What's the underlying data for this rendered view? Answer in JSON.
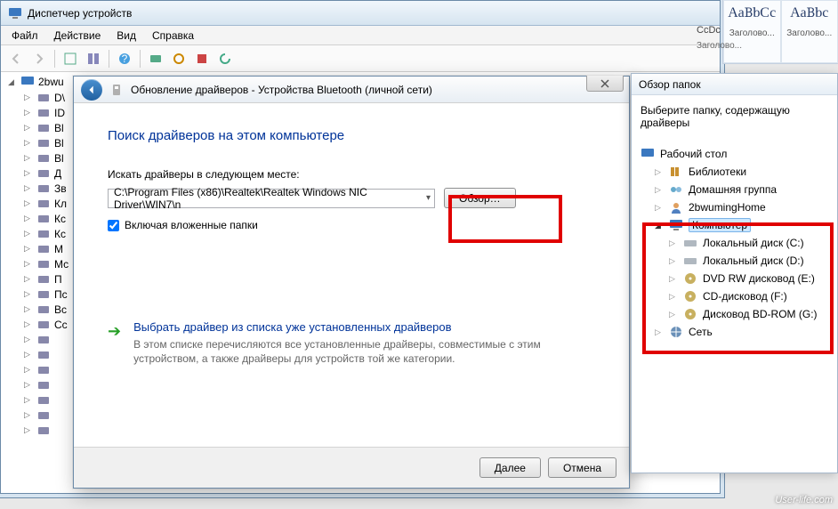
{
  "devmgr": {
    "title": "Диспетчер устройств",
    "menu": {
      "file": "Файл",
      "action": "Действие",
      "view": "Вид",
      "help": "Справка"
    },
    "root": "2bwu",
    "items": [
      "D\\",
      "ID",
      "Bl",
      "Bl",
      "Bl",
      "Д",
      "Зв",
      "Кл",
      "Кс",
      "Кс",
      "М",
      "Мс",
      "П",
      "Пс",
      "Вс",
      "Сс",
      "",
      "",
      "",
      "",
      "",
      "",
      ""
    ]
  },
  "dlg": {
    "title": "Обновление драйверов - Устройства Bluetooth (личной сети)",
    "heading": "Поиск драйверов на этом компьютере",
    "searchLabel": "Искать драйверы в следующем месте:",
    "path": "C:\\Program Files (x86)\\Realtek\\Realtek Windows NIC Driver\\WIN7\\n",
    "browse": "Обзор…",
    "includeSub": "Включая вложенные папки",
    "link": {
      "title": "Выбрать драйвер из списка уже установленных драйверов",
      "desc": "В этом списке перечисляются все установленные драйверы, совместимые с этим устройством, а также драйверы для устройств той же категории."
    },
    "next": "Далее",
    "cancel": "Отмена"
  },
  "browse": {
    "title": "Обзор папок",
    "instruction": "Выберите папку, содержащую драйверы",
    "tree": {
      "desktop": "Рабочий стол",
      "libraries": "Библиотеки",
      "homegroup": "Домашняя группа",
      "user": "2bwumingHome",
      "computer": "Компьютер",
      "diskC": "Локальный диск (C:)",
      "diskD": "Локальный диск (D:)",
      "dvd": "DVD RW дисковод (E:)",
      "cd": "CD-дисковод (F:)",
      "bd": "Дисковод BD-ROM (G:)",
      "network": "Сеть"
    }
  },
  "ribbon": {
    "ccdc": "CcDc",
    "style1": "АаBbСс",
    "style2": "АаBbс",
    "caption": "Заголово..."
  },
  "watermark": "User-life.com"
}
